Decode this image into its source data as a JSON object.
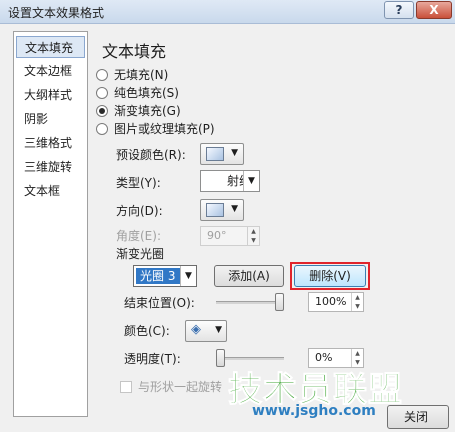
{
  "window": {
    "title": "设置文本效果格式",
    "help_label": "?",
    "close_label": "X"
  },
  "sidebar": {
    "items": [
      {
        "label": "文本填充",
        "active": true
      },
      {
        "label": "文本边框",
        "active": false
      },
      {
        "label": "大纲样式",
        "active": false
      },
      {
        "label": "阴影",
        "active": false
      },
      {
        "label": "三维格式",
        "active": false
      },
      {
        "label": "三维旋转",
        "active": false
      },
      {
        "label": "文本框",
        "active": false
      }
    ]
  },
  "main": {
    "title": "文本填充",
    "fill_options": [
      {
        "label": "无填充(N)",
        "checked": false
      },
      {
        "label": "纯色填充(S)",
        "checked": false
      },
      {
        "label": "渐变填充(G)",
        "checked": true
      },
      {
        "label": "图片或纹理填充(P)",
        "checked": false
      }
    ],
    "preset_colors_label": "预设颜色(R):",
    "type_label": "类型(Y):",
    "type_value": "射线",
    "direction_label": "方向(D):",
    "angle_label": "角度(E):",
    "angle_value": "90°",
    "gradient_stops_label": "渐变光圈",
    "stop_selected": "光圈 3",
    "add_button": "添加(A)",
    "delete_button": "删除(V)",
    "end_position_label": "结束位置(O):",
    "end_position_value": "100%",
    "end_position_level": 1.0,
    "color_label": "颜色(C):",
    "transparency_label": "透明度(T):",
    "transparency_value": "0%",
    "transparency_level": 0.0,
    "rotate_with_shape_label": "与形状一起旋转",
    "close_button": "关闭"
  },
  "watermark": {
    "text": "技术员联盟",
    "url": "www.jsgho.com"
  },
  "colors": {
    "highlight": "#e0242b",
    "selection": "#3178c6",
    "watermark_green": "#3fa535",
    "watermark_blue": "#2e7fc1"
  }
}
